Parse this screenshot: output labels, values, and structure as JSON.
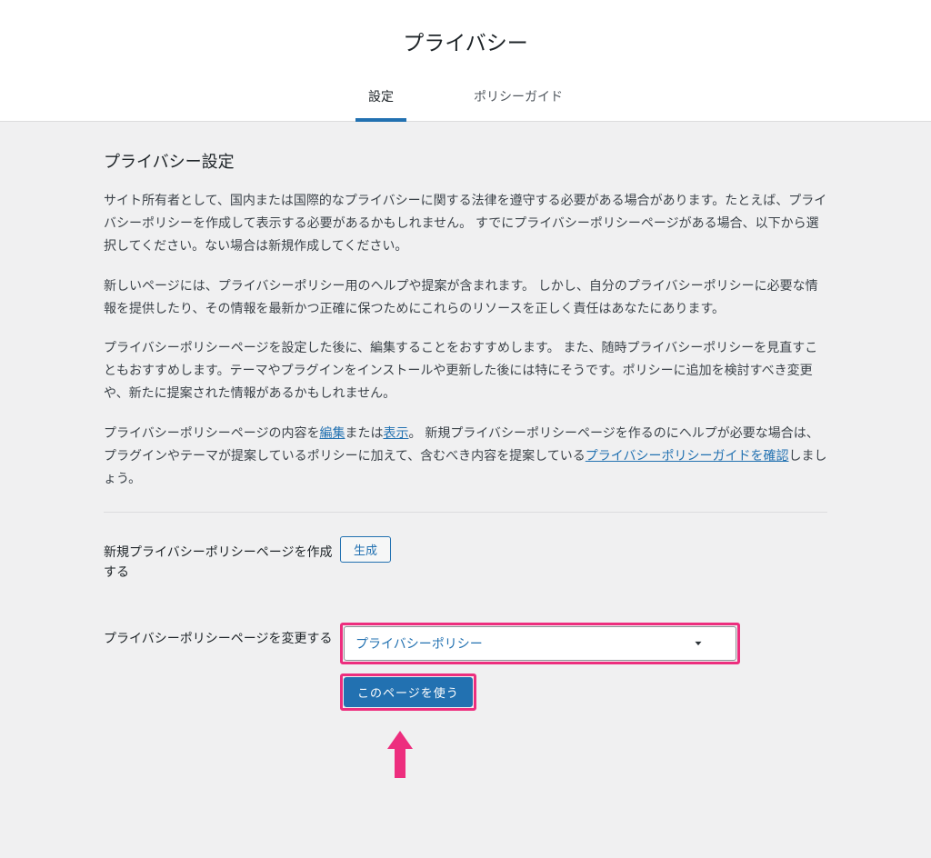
{
  "header": {
    "title": "プライバシー",
    "tabs": {
      "settings": "設定",
      "guide": "ポリシーガイド"
    }
  },
  "main": {
    "heading": "プライバシー設定",
    "p1": "サイト所有者として、国内または国際的なプライバシーに関する法律を遵守する必要がある場合があります。たとえば、プライバシーポリシーを作成して表示する必要があるかもしれません。 すでにプライバシーポリシーページがある場合、以下から選択してください。ない場合は新規作成してください。",
    "p2": "新しいページには、プライバシーポリシー用のヘルプや提案が含まれます。 しかし、自分のプライバシーポリシーに必要な情報を提供したり、その情報を最新かつ正確に保つためにこれらのリソースを正しく責任はあなたにあります。",
    "p3": "プライバシーポリシーページを設定した後に、編集することをおすすめします。 また、随時プライバシーポリシーを見直すこともおすすめします。テーマやプラグインをインストールや更新した後には特にそうです。ポリシーに追加を検討すべき変更や、新たに提案された情報があるかもしれません。",
    "p4": {
      "pre1": "プライバシーポリシーページの内容を",
      "link_edit": "編集",
      "mid1": "または",
      "link_view": "表示",
      "post1": "。 新規プライバシーポリシーページを作るのにヘルプが必要な場合は、プラグインやテーマが提案しているポリシーに加えて、含むべき内容を提案している",
      "link_guide": "プライバシーポリシーガイドを確認",
      "post2": "しましょう。"
    }
  },
  "form": {
    "create_label": "新規プライバシーポリシーページを作成する",
    "create_button": "生成",
    "change_label": "プライバシーポリシーページを変更する",
    "select_value": "プライバシーポリシー",
    "use_button": "このページを使う"
  },
  "annotation": {
    "highlight_color": "#ED2E7E"
  }
}
